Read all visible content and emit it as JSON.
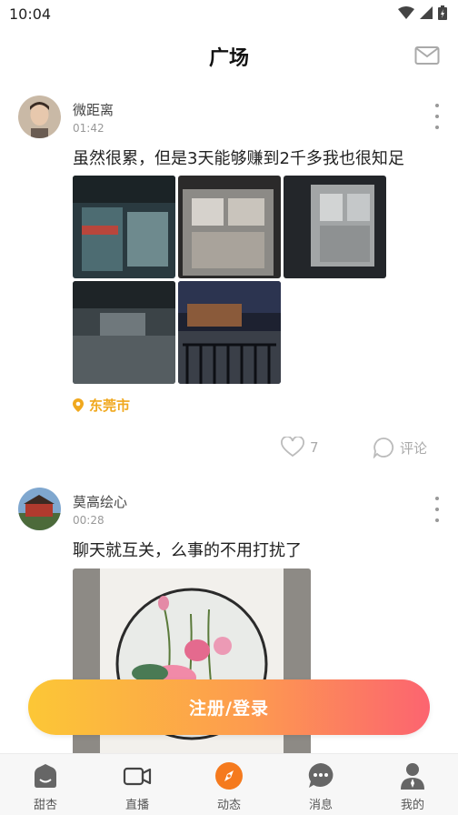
{
  "status_bar": {
    "time": "10:04"
  },
  "header": {
    "title": "广场"
  },
  "posts": [
    {
      "user": "微距离",
      "time": "01:42",
      "text": "虽然很累，但是3天能够赚到2千多我也很知足",
      "location": "东莞市",
      "likes": "7",
      "comment_label": "评论"
    },
    {
      "user": "莫高绘心",
      "time": "00:28",
      "text": "聊天就互关，么事的不用打扰了"
    }
  ],
  "login_button": "注册/登录",
  "tabs": [
    {
      "label": "甜杏",
      "icon": "home-icon"
    },
    {
      "label": "直播",
      "icon": "video-icon"
    },
    {
      "label": "动态",
      "icon": "compass-icon"
    },
    {
      "label": "消息",
      "icon": "chat-icon"
    },
    {
      "label": "我的",
      "icon": "user-icon"
    }
  ],
  "colors": {
    "accent": "#f0a81e",
    "gradient_start": "#fcc736",
    "gradient_end": "#fc6470"
  }
}
